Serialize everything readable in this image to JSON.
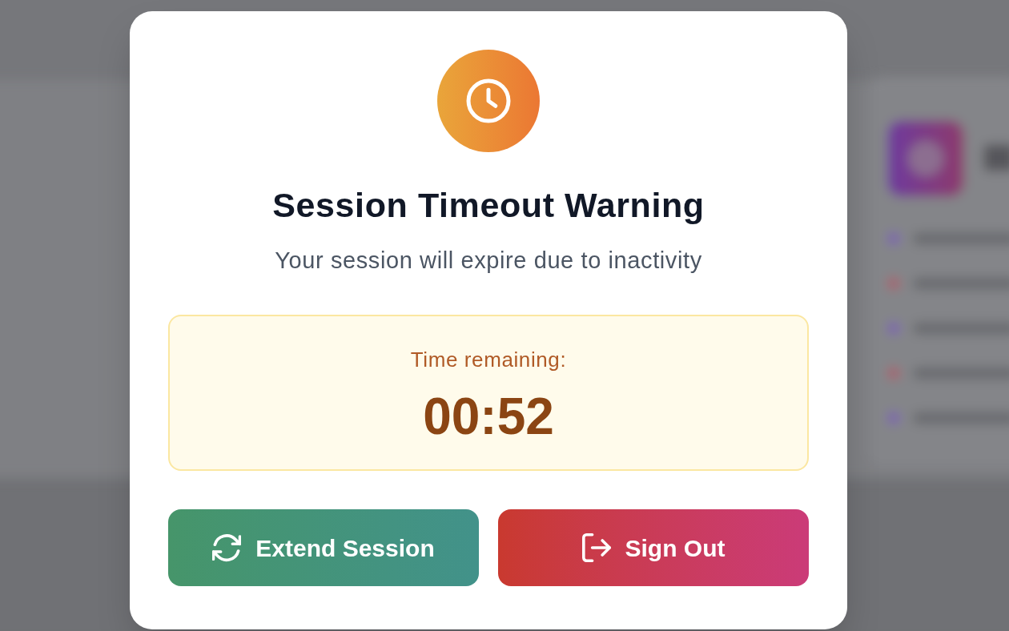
{
  "dialog": {
    "title": "Session Timeout Warning",
    "message": "Your session will expire due to inactivity",
    "countdown": {
      "label": "Time remaining:",
      "value": "00:52"
    },
    "buttons": [
      {
        "label": "Extend Session",
        "kind": "extend"
      },
      {
        "label": "Sign Out",
        "kind": "sign_out"
      }
    ]
  }
}
